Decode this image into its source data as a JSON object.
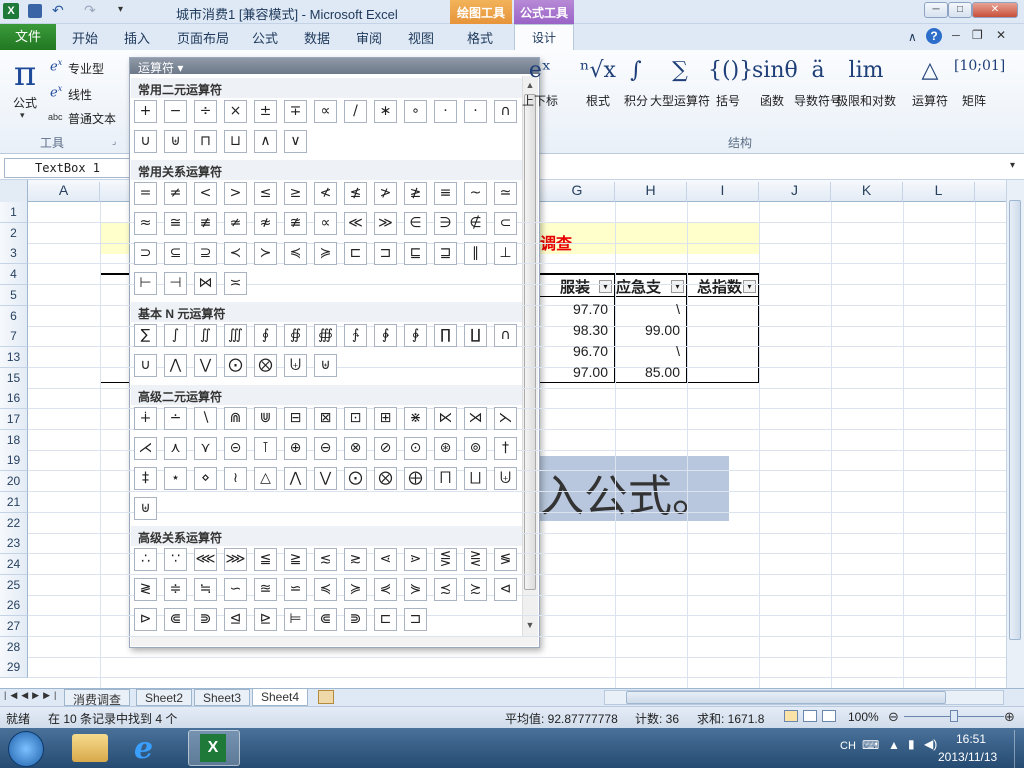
{
  "window": {
    "title": "城市消费1 [兼容模式] - Microsoft Excel",
    "context_tabs": [
      "绘图工具",
      "公式工具"
    ]
  },
  "ribbon_tabs": [
    "文件",
    "开始",
    "插入",
    "页面布局",
    "公式",
    "数据",
    "审阅",
    "视图",
    "格式",
    "设计"
  ],
  "tools_group": {
    "formula_label": "公式",
    "professional": "专业型",
    "linear": "线性",
    "plain_text": "普通文本",
    "group_label": "工具"
  },
  "structures": {
    "items": [
      {
        "symbol": "eˣ",
        "label": "上下标"
      },
      {
        "symbol": "ⁿ√x",
        "label": "根式"
      },
      {
        "symbol": "∫",
        "label": "积分"
      },
      {
        "symbol": "∑",
        "label": "大型运算符"
      },
      {
        "symbol": "{()}",
        "label": "括号"
      },
      {
        "symbol": "sinθ",
        "label": "函数"
      },
      {
        "symbol": "ä",
        "label": "导数符号"
      },
      {
        "symbol": "lim",
        "label": "极限和对数"
      },
      {
        "symbol": "△",
        "label": "运算符"
      },
      {
        "symbol": "[10;01]",
        "label": "矩阵"
      }
    ],
    "group_label": "结构"
  },
  "name_box": "TextBox 1",
  "columns": [
    "A",
    "G",
    "H",
    "I",
    "J",
    "K",
    "L"
  ],
  "rows": [
    "1",
    "2",
    "3",
    "4",
    "5",
    "6",
    "7",
    "13",
    "15",
    "16",
    "17",
    "18",
    "19",
    "20",
    "21",
    "22",
    "23",
    "24",
    "25",
    "26",
    "27",
    "28",
    "29"
  ],
  "sheet": {
    "title_fragment": "调查",
    "headers": [
      "服装",
      "应急支",
      "总指数"
    ],
    "values": [
      [
        "97.70",
        "\\",
        ""
      ],
      [
        "98.30",
        "99.00",
        ""
      ],
      [
        "96.70",
        "\\",
        ""
      ],
      [
        "97.00",
        "85.00",
        ""
      ]
    ],
    "textbox_text": "入公式。"
  },
  "operators_popup": {
    "title": "运算符",
    "sections": [
      {
        "title": "常用二元运算符",
        "symbols": [
          "+",
          "−",
          "÷",
          "×",
          "±",
          "∓",
          "∝",
          "/",
          "∗",
          "∘",
          "⋅",
          "·",
          "∩",
          "∪",
          "⊎",
          "⊓",
          "⊔",
          "∧",
          "∨"
        ]
      },
      {
        "title": "常用关系运算符",
        "symbols": [
          "=",
          "≠",
          "<",
          ">",
          "≤",
          "≥",
          "≮",
          "≰",
          "≯",
          "≱",
          "≡",
          "~",
          "≃",
          "≈",
          "≅",
          "≢",
          "≄",
          "≉",
          "≇",
          "∝",
          "≪",
          "≫",
          "∈",
          "∋",
          "∉",
          "⊂",
          "⊃",
          "⊆",
          "⊇",
          "≺",
          "≻",
          "≼",
          "≽",
          "⊏",
          "⊐",
          "⊑",
          "⊒",
          "∥",
          "⊥",
          "⊢",
          "⊣",
          "⋈",
          "≍"
        ]
      },
      {
        "title": "基本 N 元运算符",
        "symbols": [
          "∑",
          "∫",
          "∬",
          "∭",
          "∮",
          "∯",
          "∰",
          "∱",
          "∲",
          "∳",
          "∏",
          "∐",
          "∩",
          "∪",
          "⋀",
          "⋁",
          "⨀",
          "⨂",
          "⨄",
          "⊎"
        ]
      },
      {
        "title": "高级二元运算符",
        "symbols": [
          "∔",
          "∸",
          "∖",
          "⋒",
          "⋓",
          "⊟",
          "⊠",
          "⊡",
          "⊞",
          "⋇",
          "⋉",
          "⋊",
          "⋋",
          "⋌",
          "⋏",
          "⋎",
          "⊝",
          "⊺",
          "⊕",
          "⊖",
          "⊗",
          "⊘",
          "⊙",
          "⊛",
          "⊚",
          "†",
          "‡",
          "⋆",
          "⋄",
          "≀",
          "△",
          "⋀",
          "⋁",
          "⨀",
          "⨂",
          "⨁",
          "⨅",
          "⨆",
          "⨄",
          "⊎"
        ]
      },
      {
        "title": "高级关系运算符",
        "symbols": [
          "∴",
          "∵",
          "⋘",
          "⋙",
          "≦",
          "≧",
          "≲",
          "≳",
          "⋖",
          "⋗",
          "⋚",
          "⋛",
          "≶",
          "≷",
          "≑",
          "≒",
          "∽",
          "≊",
          "⋍",
          "≼",
          "≽",
          "⋞",
          "⋟",
          "≾",
          "≿",
          "⊲",
          "⊳",
          "⋐",
          "⋑",
          "⊴",
          "⊵",
          "⊨",
          "⋐",
          "⋑",
          "⊏",
          "⊐"
        ]
      }
    ]
  },
  "sheet_tabs": [
    "消费调查",
    "Sheet2",
    "Sheet3",
    "Sheet4"
  ],
  "status": {
    "ready": "就绪",
    "filter": "在 10 条记录中找到 4 个",
    "average": "平均值: 92.87777778",
    "count": "计数: 36",
    "sum": "求和: 1671.8",
    "zoom": "100%"
  },
  "taskbar": {
    "lang": "CH",
    "time": "16:51",
    "date": "2013/11/13"
  },
  "colors": {
    "file_tab": "#217821",
    "draw_tools": "#e7943a",
    "formula_tools": "#9a63c7",
    "title_red": "#e60000",
    "header_yellow": "#ffffcc",
    "textbox_fill": "#b8c7dd"
  }
}
